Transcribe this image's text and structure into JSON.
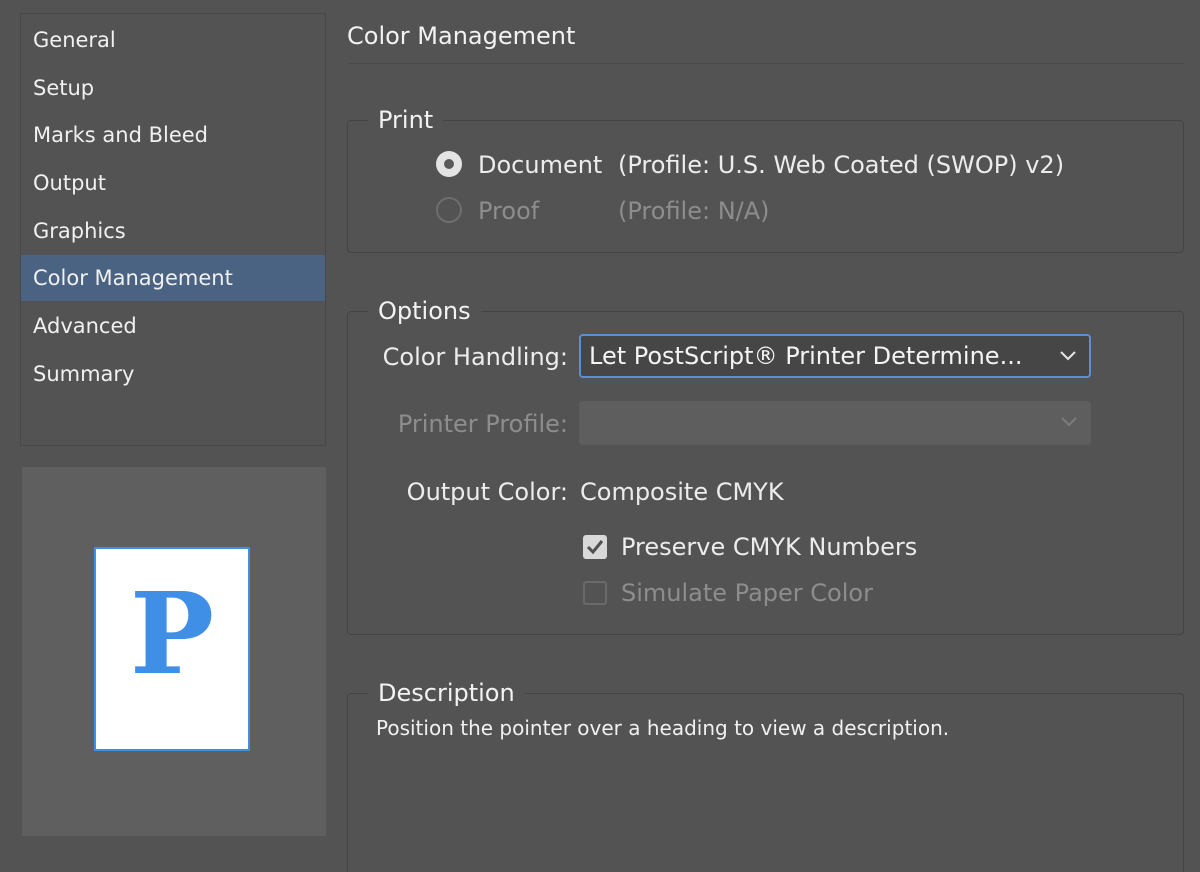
{
  "sidebar": {
    "items": [
      {
        "label": "General"
      },
      {
        "label": "Setup"
      },
      {
        "label": "Marks and Bleed"
      },
      {
        "label": "Output"
      },
      {
        "label": "Graphics"
      },
      {
        "label": "Color Management",
        "selected": true
      },
      {
        "label": "Advanced"
      },
      {
        "label": "Summary"
      }
    ]
  },
  "preview": {
    "letter": "P",
    "page_color": "#ffffff",
    "accent": "#3f8fe6"
  },
  "main": {
    "title": "Color Management",
    "print": {
      "label": "Print",
      "options": [
        {
          "label": "Document",
          "profile": "(Profile: U.S. Web Coated (SWOP) v2)",
          "selected": true,
          "enabled": true
        },
        {
          "label": "Proof",
          "profile": "(Profile: N/A)",
          "selected": false,
          "enabled": false
        }
      ]
    },
    "options": {
      "label": "Options",
      "color_handling": {
        "label": "Color Handling:",
        "value": "Let PostScript® Printer Determine..."
      },
      "printer_profile": {
        "label": "Printer Profile:",
        "value": "",
        "enabled": false
      },
      "output_color": {
        "label": "Output Color:",
        "value": "Composite CMYK"
      },
      "preserve_cmyk": {
        "label": "Preserve CMYK Numbers",
        "checked": true,
        "enabled": true
      },
      "simulate_paper": {
        "label": "Simulate Paper Color",
        "checked": false,
        "enabled": false
      }
    },
    "description": {
      "label": "Description",
      "text": "Position the pointer over a heading to view a description."
    }
  },
  "colors": {
    "selection": "#4b6382",
    "focus_ring": "#5b8fd4",
    "background": "#535353"
  }
}
